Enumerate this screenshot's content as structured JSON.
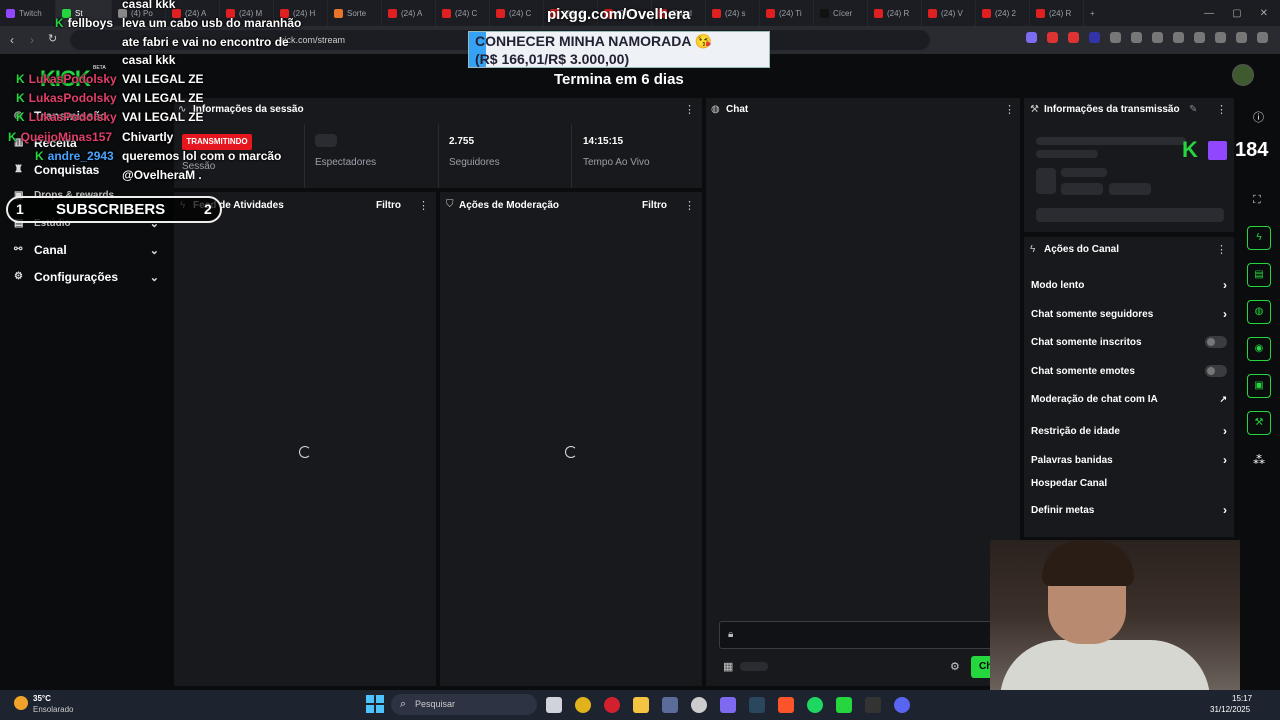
{
  "browser": {
    "tabs": [
      {
        "label": "Twitch",
        "color": "#9146ff"
      },
      {
        "label": "St",
        "color": "#25d63e",
        "active": true
      },
      {
        "label": "(4) Po",
        "color": "#888888"
      },
      {
        "label": "(24) A",
        "color": "#e02020"
      },
      {
        "label": "(24) M",
        "color": "#e02020"
      },
      {
        "label": "(24) H",
        "color": "#e02020"
      },
      {
        "label": "Sorte",
        "color": "#e8742a"
      },
      {
        "label": "(24) A",
        "color": "#e02020"
      },
      {
        "label": "(24) C",
        "color": "#e02020"
      },
      {
        "label": "(24) C",
        "color": "#e02020"
      },
      {
        "label": "(24) Q",
        "color": "#e02020"
      },
      {
        "label": "(24) s",
        "color": "#e02020"
      },
      {
        "label": "(24) d",
        "color": "#e02020"
      },
      {
        "label": "(24) s",
        "color": "#e02020"
      },
      {
        "label": "(24) Ti",
        "color": "#e02020"
      },
      {
        "label": "Cícer",
        "color": "#111111"
      },
      {
        "label": "(24) R",
        "color": "#e02020"
      },
      {
        "label": "(24) V",
        "color": "#e02020"
      },
      {
        "label": "(24) 2",
        "color": "#e02020"
      },
      {
        "label": "(24) R",
        "color": "#e02020"
      }
    ],
    "new_tab": "+",
    "url": "kick.com/stream"
  },
  "kick": {
    "logo": "KICK",
    "logo_sup": "BETA",
    "stream_title": "Termina em 6 dias",
    "nav": {
      "transmissao": "Transmissão",
      "receita": "Receita",
      "conquistas": "Conquistas",
      "drops": "Drops & rewards",
      "estudio": "Estúdio",
      "canal": "Canal",
      "configuracoes": "Configurações"
    },
    "session": {
      "title": "Informações da sessão",
      "live_badge": "TRANSMITINDO",
      "session_label": "Sessão",
      "viewers_label": "Espectadores",
      "followers_value": "2.755",
      "followers_label": "Seguidores",
      "uptime_value": "14:15:15",
      "uptime_label": "Tempo Ao Vivo"
    },
    "activity": {
      "title": "Feed de Atividades",
      "filter": "Filtro"
    },
    "moderation": {
      "title": "Ações de Moderação",
      "filter": "Filtro"
    },
    "chat": {
      "title": "Chat",
      "send_button": "Chat"
    },
    "stream_info": {
      "title": "Informações da transmissão"
    },
    "channel_actions": {
      "title": "Ações do Canal",
      "items": [
        {
          "label": "Modo lento",
          "control": "arrow"
        },
        {
          "label": "Chat somente seguidores",
          "control": "arrow"
        },
        {
          "label": "Chat somente inscritos",
          "control": "toggle"
        },
        {
          "label": "Chat somente emotes",
          "control": "toggle"
        },
        {
          "label": "Moderação de chat com IA",
          "control": "external"
        },
        {
          "label": "Restrição de idade",
          "control": "arrow"
        },
        {
          "label": "Palavras banidas",
          "control": "arrow"
        },
        {
          "label": "Hospedar Canal",
          "control": "none"
        },
        {
          "label": "Definir metas",
          "control": "arrow"
        }
      ]
    }
  },
  "overlay": {
    "pix_url": "pixgg.com/Ovelhera",
    "donation_goal_text": "CONHECER MINHA NAMORADA 😘",
    "donation_amount": "(R$ 166,01/R$ 3.000,00)",
    "donation_progress": 0.055,
    "chat_lines": [
      {
        "user": "",
        "text": "casal kkk"
      },
      {
        "user": "fellboys",
        "text": "leva um cabo usb do maranhão"
      },
      {
        "user": "",
        "text": "ate fabri e vai no encontro de"
      },
      {
        "user": "",
        "text": "casal kkk"
      },
      {
        "user": "LukasPodolsky",
        "text": "VAI LEGAL ZE"
      },
      {
        "user": "LukasPodolsky",
        "text": "VAI LEGAL ZE"
      },
      {
        "user": "LukasPodolsky",
        "text": "VAI LEGAL ZE"
      },
      {
        "user": "QueijoMinas157",
        "text": "Chivartly"
      },
      {
        "user": "andre_2943",
        "text": "queremos lol com o marcão"
      },
      {
        "user": "",
        "text": "@OvelheraM ."
      }
    ],
    "subs_left": "1",
    "subs_label": "SUBSCRIBERS",
    "subs_right": "2",
    "twitch_count": "184"
  },
  "taskbar": {
    "weather_temp": "35°C",
    "weather_desc": "Ensolarado",
    "search_placeholder": "Pesquisar",
    "time": "15:17",
    "date": "31/12/2025"
  }
}
